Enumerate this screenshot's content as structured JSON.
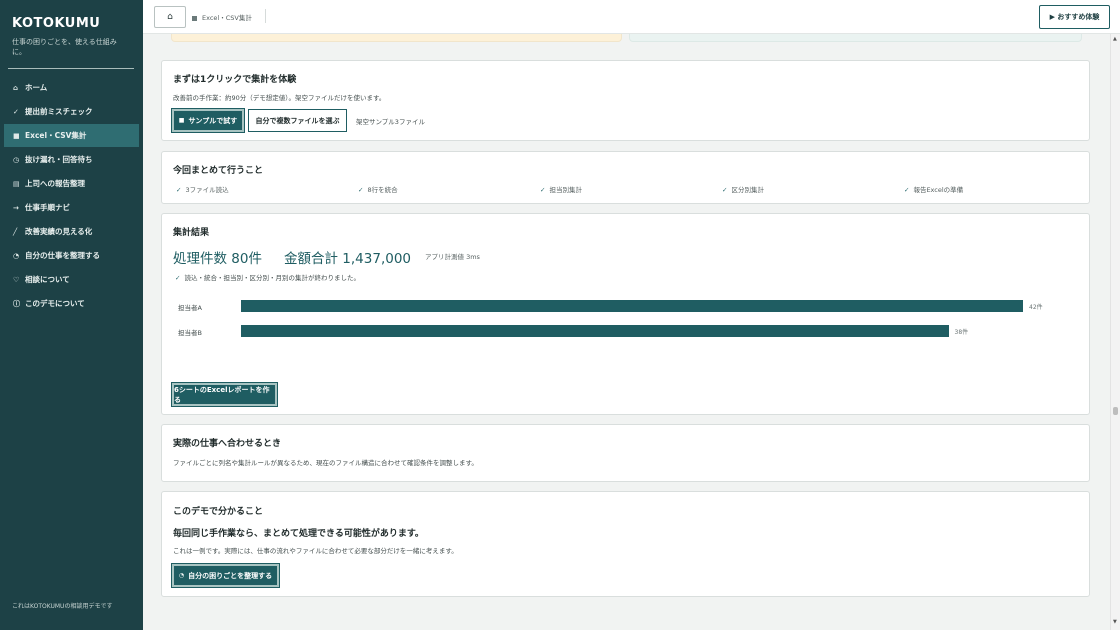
{
  "sidebar": {
    "brand": "KOTOKUMU",
    "tagline": "仕事の困りごとを、使える仕組みに。",
    "items": [
      {
        "icon": "⌂",
        "label": "ホーム"
      },
      {
        "icon": "✓",
        "label": "提出前ミスチェック"
      },
      {
        "icon": "■",
        "label": "Excel・CSV集計"
      },
      {
        "icon": "◷",
        "label": "抜け漏れ・回答待ち"
      },
      {
        "icon": "▤",
        "label": "上司への報告整理"
      },
      {
        "icon": "→",
        "label": "仕事手順ナビ"
      },
      {
        "icon": "╱",
        "label": "改善実績の見える化"
      },
      {
        "icon": "◔",
        "label": "自分の仕事を整理する"
      },
      {
        "icon": "♡",
        "label": "相談について"
      },
      {
        "icon": "ⓘ",
        "label": "このデモについて"
      }
    ],
    "active_index": 2,
    "footer": "これはKOTOKUMUの相談用デモです"
  },
  "topbar": {
    "home_icon": "⌂",
    "breadcrumb": "Excel・CSV集計",
    "recommend_label": "▶ おすすめ体験"
  },
  "quick": {
    "title": "まずは1クリックで集計を体験",
    "desc": "改善前の手作業：約90分（デモ想定値）。架空ファイルだけを使います。",
    "sample_button": "サンプルで試す",
    "choose_button": "自分で複数ファイルを選ぶ",
    "note": "架空サンプル3ファイル"
  },
  "todo": {
    "title": "今回まとめて行うこと",
    "items": [
      "3ファイル読込",
      "8行を統合",
      "担当別集計",
      "区分別集計",
      "報告Excelの準備"
    ]
  },
  "result": {
    "title": "集計結果",
    "count_text": "処理件数 80件",
    "total_text": "金額合計 1,437,000",
    "timing": "アプリ計測値 3ms",
    "done_text": "読込・統合・担当別・区分別・月別の集計が終わりました。",
    "report_button": "6シートのExcelレポートを作る"
  },
  "chart_data": {
    "type": "bar",
    "orientation": "horizontal",
    "categories": [
      "担当者A",
      "担当者B"
    ],
    "values": [
      42,
      38
    ],
    "value_labels": [
      "42件",
      "38件"
    ],
    "xlim": [
      0,
      42
    ],
    "color": "#1f5d62"
  },
  "adjust": {
    "title": "実際の仕事へ合わせるとき",
    "desc": "ファイルごとに列名や集計ルールが異なるため、現在のファイル構造に合わせて確認条件を調整します。"
  },
  "learn": {
    "title": "このデモで分かること",
    "lead": "毎回同じ手作業なら、まとめて処理できる可能性があります。",
    "desc": "これは一例です。実際には、仕事の流れやファイルに合わせて必要な部分だけを一緒に考えます。",
    "button": "自分の困りごとを整理する"
  },
  "colors": {
    "sidebar_bg": "#1d4146",
    "sidebar_active": "#2f6d72",
    "accent": "#1f5d62",
    "page_bg": "#f1f3f2"
  }
}
